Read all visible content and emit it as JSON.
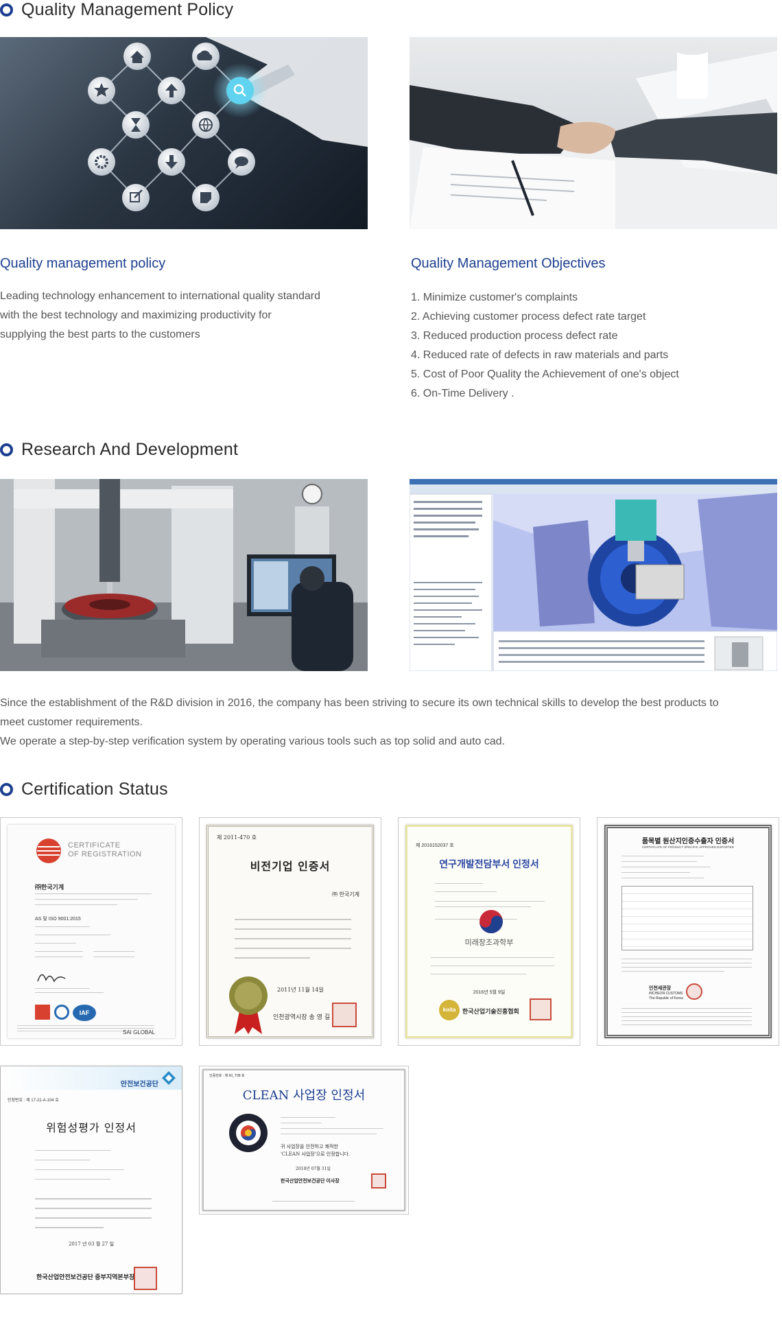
{
  "sections": {
    "quality": {
      "title": "Quality Management Policy",
      "policy_heading": "Quality management policy",
      "policy_lines": [
        "Leading technology enhancement to international quality standard",
        "with the best technology and maximizing productivity for",
        "supplying the best parts to the customers"
      ],
      "objectives_heading": "Quality Management Objectives",
      "objectives": [
        "1. Minimize customer's complaints",
        "2. Achieving customer process defect rate target",
        "3. Reduced production process defect rate",
        "4. Reduced rate of defects in raw materials and parts",
        "5. Cost of Poor Quality the Achievement of one's object",
        "6. On-Time Delivery ."
      ]
    },
    "rnd": {
      "title": "Research And Development",
      "lines": [
        "Since the establishment of the R&D division in 2016, the company has been striving to secure its own technical skills to develop the best products to",
        "meet customer requirements.",
        "We operate a step-by-step verification system by operating various tools such as top solid and auto cad."
      ]
    },
    "certs": {
      "title": "Certification Status",
      "c1": {
        "heading1": "CERTIFICATE",
        "heading2": "OF REGISTRATION",
        "company": "㈜한국기계",
        "standard": "AS 및 ISO 9001:2015",
        "iaf": "IAF",
        "brand": "SAI GLOBAL"
      },
      "c2": {
        "number": "제 2011-470 호",
        "title": "비전기업 인증서",
        "company": "㈜ 한국기계",
        "date": "2011년 11월 14일",
        "issuer": "인천광역시장 송 영 길"
      },
      "c3": {
        "number": "제 2016152037 호",
        "title": "연구개발전담부서 인정서",
        "ministry": "미래창조과학부",
        "date": "2016년 5월 9일",
        "issuer": "한국산업기술진흥협회",
        "badge": "koita"
      },
      "c4": {
        "title": "품목별 원산지인증수출자 인증서",
        "subtitle": "CERTIFICATE OF PRODUCT SPECIFIC APPROVED EXPORTER",
        "issuer": "인천세관장",
        "issuer_en": "INCHEON CUSTOMS",
        "country": "The Republic of Korea"
      },
      "c5": {
        "agency": "안전보건공단",
        "number": "인정번호 : 제 17-21-A-104 호",
        "title": "위험성평가 인정서",
        "date": "2017 년   03 월   27 일",
        "issuer": "한국산업안전보건공단 중부지역본부장"
      },
      "c6": {
        "number": "인증번호 : 제 60_T08 호",
        "title": "CLEAN 사업장 인정서",
        "statement_1": "귀 사업장을 안전하고 쾌적한",
        "statement_2": "'CLEAN 사업장'으로 인정합니다.",
        "date": "2018년  07월  31일",
        "issuer": "한국산업안전보건공단 이사장",
        "seal": "CLEAN WORKPLACE"
      }
    }
  },
  "colors": {
    "accent": "#1d3f8f",
    "text": "#555555",
    "heading": "#2a2a2a"
  },
  "icons": [
    "home-icon",
    "cloud-icon",
    "star-icon",
    "up-arrow-icon",
    "search-icon",
    "hourglass-icon",
    "globe-icon",
    "gear-icon",
    "down-arrow-icon",
    "chat-icon",
    "edit-icon",
    "note-icon"
  ]
}
